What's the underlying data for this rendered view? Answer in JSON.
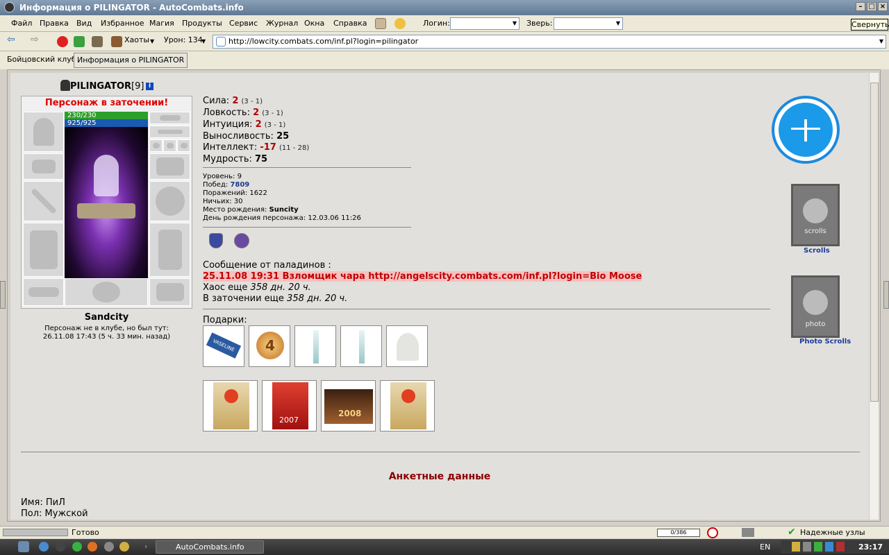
{
  "window": {
    "title": "Информация о PILINGATOR - AutoCombats.info",
    "tooltip": "Свернуть"
  },
  "menu": [
    "Файл",
    "Правка",
    "Вид",
    "Избранное",
    "Магия",
    "Продукты",
    "Сервис",
    "Журнал",
    "Окна",
    "Справка"
  ],
  "menu_fields": {
    "login_label": "Логин:",
    "login_value": "",
    "beast_label": "Зверь:",
    "beast_value": ""
  },
  "toolbar": {
    "chaos_label": "Хаоты",
    "damage_label": "Урон: 134",
    "url": "http://lowcity.combats.com/inf.pl?login=pilingator"
  },
  "tabs": [
    "Бойцовский клуб",
    "Информация о PILINGATOR"
  ],
  "profile": {
    "name": "PILINGATOR",
    "level_tag": "[9]",
    "prison_banner": "Персонаж в заточении!",
    "hp": "230/230",
    "mana": "925/925",
    "city": "Sandcity",
    "club_note": "Персонаж не в клубе, но был тут:",
    "last_seen": "26.11.08 17:43 (5 ч. 33 мин. назад)"
  },
  "stats": [
    {
      "label": "Сила: ",
      "value": "2",
      "extra": "(3 - 1)"
    },
    {
      "label": "Ловкость: ",
      "value": "2",
      "extra": "(3 - 1)"
    },
    {
      "label": "Интуиция: ",
      "value": "2",
      "extra": "(3 - 1)"
    },
    {
      "label": "Выносливость: ",
      "value": "25",
      "extra": ""
    },
    {
      "label": "Интеллект: ",
      "value": "-17",
      "extra": "(11 - 28)"
    },
    {
      "label": "Мудрость: ",
      "value": "75",
      "extra": ""
    }
  ],
  "info": {
    "level": "Уровень: 9",
    "wins_label": "Побед: ",
    "wins": "7809",
    "losses": "Поражений: 1622",
    "draws": "Ничьих: 30",
    "birthplace_label": "Место рождения: ",
    "birthplace": "Suncity",
    "birthday": "День рождения персонажа: 12.03.06 11:26"
  },
  "paladin": {
    "header": "Сообщение от паладинов :",
    "message": "25.11.08 19:31 Взломщик чара http://angelscity.combats.com/inf.pl?login=Bio Moose",
    "chaos_label": "Хаос еще ",
    "chaos_time": "358 дн. 20 ч.",
    "prison_label": "В заточении еще ",
    "prison_time": "358 дн. 20 ч."
  },
  "gifts_label": "Подарки:",
  "sidebar": {
    "scrolls": "Scrolls",
    "photo_scrolls": "Photo Scrolls",
    "scrolls_banner": "scrolls",
    "photo_banner": "photo"
  },
  "anketa": {
    "title": "Анкетные данные",
    "name": "Имя: ПиЛ",
    "sex": "Пол: Мужской"
  },
  "status": {
    "text": "Готово",
    "counter": "0/386",
    "trusted": "Надежные узлы"
  },
  "taskbar": {
    "app": "AutoCombats.info",
    "lang": "EN",
    "time": "23:17"
  },
  "gift_cards": [
    "2007",
    "2008"
  ],
  "gift_text": [
    "VASELINE",
    "4"
  ]
}
